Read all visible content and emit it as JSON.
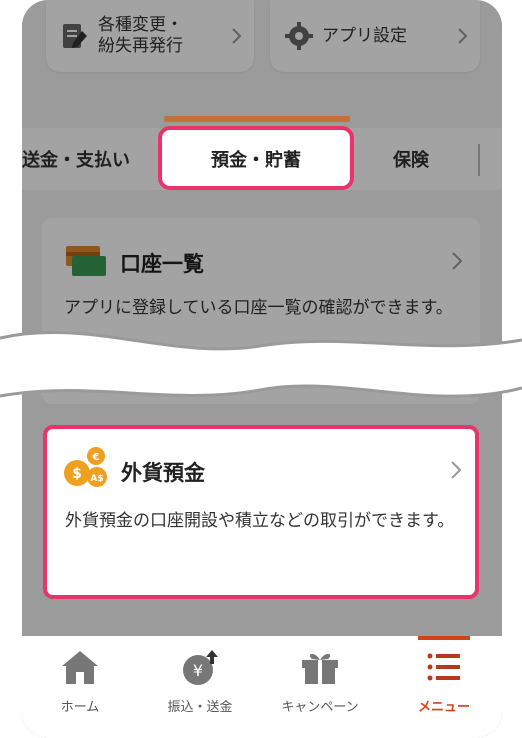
{
  "top_menu": {
    "left_label": "各種変更・\n紛失再発行",
    "right_label": "アプリ設定"
  },
  "tabs": {
    "send_pay": "送金・支払い",
    "deposit": "預金・貯蓄",
    "insurance": "保険"
  },
  "card_accounts": {
    "title": "口座一覧",
    "desc": "アプリに登録している口座一覧の確認ができます。"
  },
  "card_fx": {
    "title": "外貨預金",
    "desc": "外貨預金の口座開設や積立などの取引ができます。",
    "coin_labels": [
      "$",
      "€",
      "A$"
    ]
  },
  "bottom_nav": {
    "home": "ホーム",
    "transfer": "振込・送金",
    "campaign": "キャンペーン",
    "menu": "メニュー"
  },
  "colors": {
    "highlight": "#e8336b",
    "accent": "#d4421b",
    "tab_bar": "#c2713d"
  }
}
